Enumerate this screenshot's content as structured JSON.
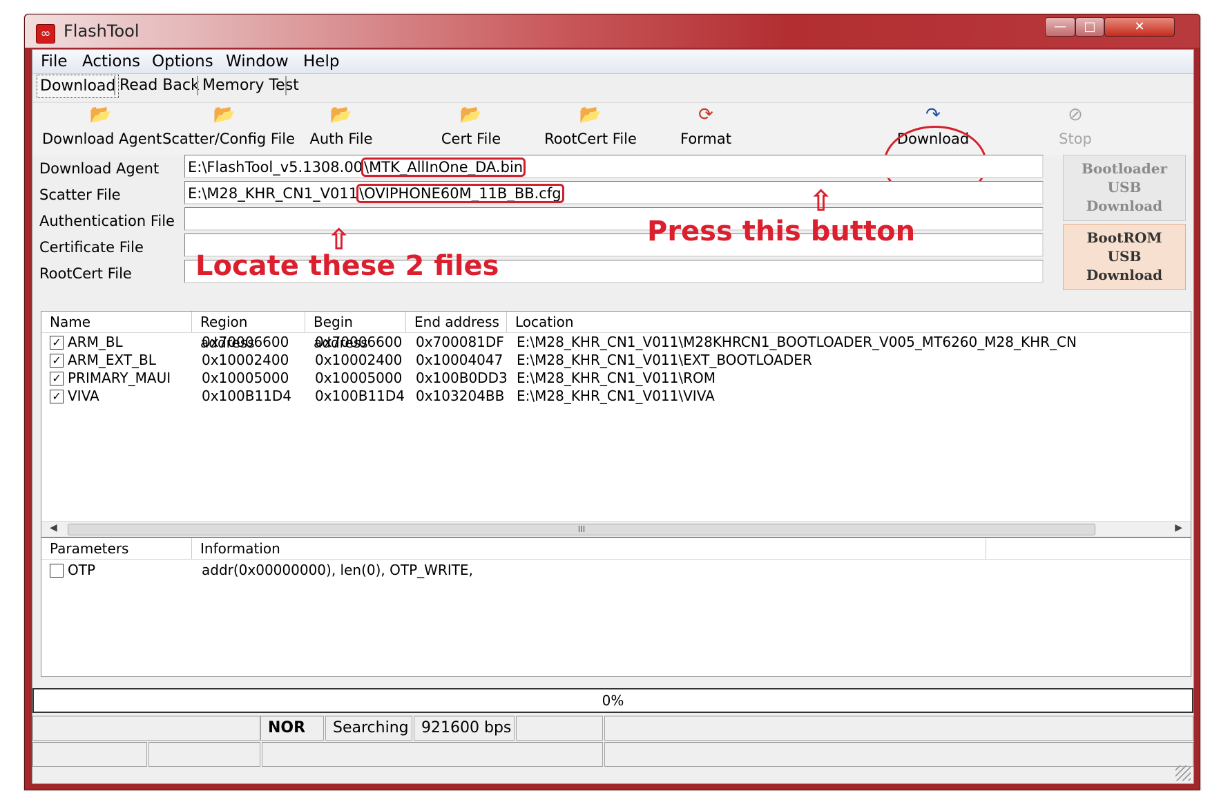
{
  "window": {
    "title": "FlashTool"
  },
  "menu": [
    "File",
    "Actions",
    "Options",
    "Window",
    "Help"
  ],
  "tabs": [
    "Download",
    "Read Back",
    "Memory Test"
  ],
  "toolbar": {
    "download_agent": "Download Agent",
    "scatter_config": "Scatter/Config File",
    "auth_file": "Auth File",
    "cert_file": "Cert File",
    "rootcert_file": "RootCert File",
    "format": "Format",
    "download": "Download",
    "stop": "Stop"
  },
  "fields": {
    "download_agent": {
      "label": "Download Agent",
      "value_prefix": "E:\\FlashTool_v5.1308.00",
      "value_highlight": "\\MTK_AllInOne_DA.bin"
    },
    "scatter_file": {
      "label": "Scatter File",
      "value_prefix": "E:\\M28_KHR_CN1_V011",
      "value_highlight": "\\OVIPHONE60M_11B_BB.cfg"
    },
    "authentication_file": {
      "label": "Authentication File",
      "value": ""
    },
    "certificate_file": {
      "label": "Certificate File",
      "value": ""
    },
    "rootcert_file": {
      "label": "RootCert File",
      "value": ""
    }
  },
  "side_buttons": {
    "bootloader": [
      "Bootloader",
      "USB",
      "Download"
    ],
    "bootrom": [
      "BootROM",
      "USB",
      "Download"
    ]
  },
  "annotations": {
    "press": "Press this button",
    "locate": "Locate these 2 files"
  },
  "table": {
    "headers": [
      "Name",
      "Region address",
      "Begin address",
      "End address",
      "Location"
    ],
    "rows": [
      {
        "checked": true,
        "name": "ARM_BL",
        "region": "0x70006600",
        "begin": "0x70006600",
        "end": "0x700081DF",
        "location": "E:\\M28_KHR_CN1_V011\\M28KHRCN1_BOOTLOADER_V005_MT6260_M28_KHR_CN"
      },
      {
        "checked": true,
        "name": "ARM_EXT_BL",
        "region": "0x10002400",
        "begin": "0x10002400",
        "end": "0x10004047",
        "location": "E:\\M28_KHR_CN1_V011\\EXT_BOOTLOADER"
      },
      {
        "checked": true,
        "name": "PRIMARY_MAUI",
        "region": "0x10005000",
        "begin": "0x10005000",
        "end": "0x100B0DD3",
        "location": "E:\\M28_KHR_CN1_V011\\ROM"
      },
      {
        "checked": true,
        "name": "VIVA",
        "region": "0x100B11D4",
        "begin": "0x100B11D4",
        "end": "0x103204BB",
        "location": "E:\\M28_KHR_CN1_V011\\VIVA"
      }
    ],
    "scroll_grip": "III"
  },
  "params": {
    "headers": [
      "Parameters",
      "Information"
    ],
    "rows": [
      {
        "checked": false,
        "name": "OTP",
        "info": "addr(0x00000000), len(0), OTP_WRITE,"
      }
    ]
  },
  "progress": {
    "text": "0%",
    "value": 0
  },
  "status": {
    "type": "NOR",
    "state": "Searching",
    "baud": "921600 bps"
  },
  "colors": {
    "annotation": "#dc1f2e",
    "titlebar": "#b22e31"
  }
}
